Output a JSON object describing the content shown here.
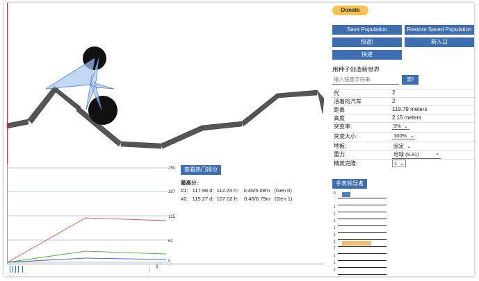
{
  "top_buttons": {
    "donate": "Donate",
    "save_population": "Save Population",
    "restore_population": "Restore Saved Population",
    "reset": "快遊!",
    "new_population": "新入口",
    "fast": "快进"
  },
  "seed": {
    "label": "用种子创造新世界",
    "placeholder": "输入任意字符串",
    "go": "去!"
  },
  "stats": [
    {
      "key": "代",
      "value": "2"
    },
    {
      "key": "活着的汽车",
      "value": "2"
    },
    {
      "key": "距离",
      "value": "119.79 meters"
    },
    {
      "key": "高度",
      "value": "2.15 meters"
    }
  ],
  "settings": [
    {
      "key": "突变率:",
      "value": "5%"
    },
    {
      "key": "突变大小:",
      "value": "100%"
    },
    {
      "key": "地板:",
      "value": "固定"
    },
    {
      "key": "重力:",
      "value": "地球  (9.81)"
    },
    {
      "key": "精英克隆:",
      "value": "1"
    }
  ],
  "graph": {
    "y_ticks": [
      "250",
      "187",
      "125",
      "62",
      "0"
    ],
    "minimap_zero": "0"
  },
  "top_scores": {
    "view_button": "查看热门得分",
    "title": "最高分:",
    "lines": [
      "#1:   117.98 d:  112.23 h:    0.46/5.08m   (Gen 0)",
      "#2:   115.27 d:  107.02 h:    0.46/6.79m   (Gen 1)"
    ]
  },
  "leader": {
    "watch_button": "手表领导者",
    "numbers": [
      "0",
      "",
      "1",
      "1",
      "1",
      "1",
      "1",
      "1",
      "7",
      "1",
      "1",
      "1"
    ]
  },
  "colors": {
    "button": "#3e6eb0",
    "donate": "#f7c34a",
    "series_red": "#e05050",
    "series_green": "#50b030",
    "series_blue": "#4060c0",
    "leader_bar_blue": "#4a80c8",
    "leader_bar_orange": "#f0c070"
  }
}
